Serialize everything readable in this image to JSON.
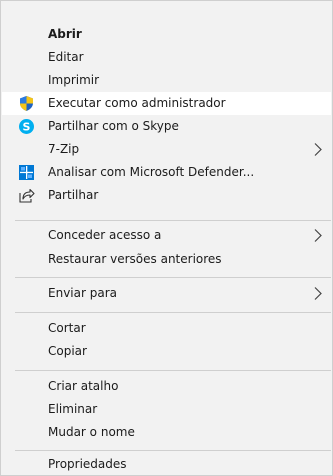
{
  "menu": {
    "open": "Abrir",
    "edit": "Editar",
    "print": "Imprimir",
    "run_as_admin": "Executar como administrador",
    "share_skype": "Partilhar com o Skype",
    "zip": "7-Zip",
    "defender": "Analisar com Microsoft Defender...",
    "share": "Partilhar",
    "grant_access": "Conceder acesso a",
    "restore_versions": "Restaurar versões anteriores",
    "send_to": "Enviar para",
    "cut": "Cortar",
    "copy": "Copiar",
    "create_shortcut": "Criar atalho",
    "delete": "Eliminar",
    "rename": "Mudar o nome",
    "properties": "Propriedades"
  },
  "icons": {
    "admin": "uac-shield-icon",
    "skype": "skype-icon",
    "defender": "defender-icon",
    "share": "share-icon",
    "submenu": "chevron-right-icon"
  },
  "colors": {
    "background": "#f2f2f2",
    "highlight": "#ffffff",
    "separator": "#cfcfcf",
    "text": "#1b1b1b",
    "skype_blue": "#00aff0",
    "defender_blue": "#0078d4"
  }
}
